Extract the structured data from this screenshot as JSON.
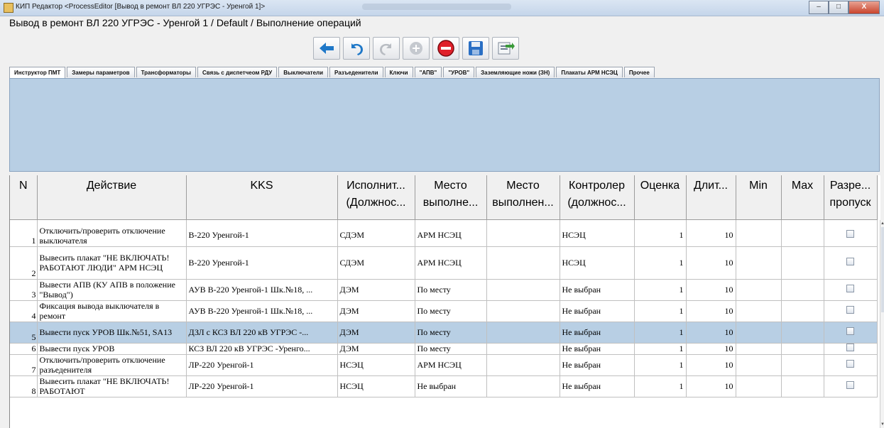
{
  "window": {
    "title": "КИП Редактор <ProcessEditor [Вывод в ремонт ВЛ 220 УГРЭС - Уренгой 1]>",
    "buttons": {
      "minimize": "‒",
      "maximize": "□",
      "close": "X"
    }
  },
  "header": {
    "title": "Вывод в ремонт ВЛ 220 УГРЭС - Уренгой 1 / Default /   Выполнение операций"
  },
  "toolbar": {
    "buttons": [
      {
        "icon": "arrow-left-icon",
        "color": "#1f78c8"
      },
      {
        "icon": "undo-icon",
        "color": "#1f78c8"
      },
      {
        "icon": "redo-icon",
        "color": "#b8bcc2"
      },
      {
        "icon": "add-icon",
        "color": "#b8bcc2"
      },
      {
        "icon": "stop-icon",
        "color": "#e0202a"
      },
      {
        "icon": "save-icon",
        "color": "#2a6fc4"
      },
      {
        "icon": "export-icon",
        "color": "#3a7a3a"
      }
    ]
  },
  "tabs": [
    {
      "label": "Инструктор ПМТ",
      "active": true
    },
    {
      "label": "Замеры параметров"
    },
    {
      "label": "Трансформаторы"
    },
    {
      "label": "Связь с диспетчеом РДУ"
    },
    {
      "label": "Выключатели"
    },
    {
      "label": "Разъеденители"
    },
    {
      "label": "Ключи"
    },
    {
      "label": "\"АПВ\""
    },
    {
      "label": "\"УРОВ\""
    },
    {
      "label": "Заземляющие ножи (ЗН)"
    },
    {
      "label": "Плакаты АРМ НСЭЦ"
    },
    {
      "label": "Прочее"
    }
  ],
  "table": {
    "columns": [
      {
        "l1": "N",
        "l2": ""
      },
      {
        "l1": "Действие",
        "l2": ""
      },
      {
        "l1": "KKS",
        "l2": ""
      },
      {
        "l1": "Исполнит...",
        "l2": "(Должнос..."
      },
      {
        "l1": "Место",
        "l2": "выполне..."
      },
      {
        "l1": "Место",
        "l2": "выполнен..."
      },
      {
        "l1": "Контролер",
        "l2": "(должнос..."
      },
      {
        "l1": "Оценка",
        "l2": ""
      },
      {
        "l1": "Длит...",
        "l2": ""
      },
      {
        "l1": "Min",
        "l2": ""
      },
      {
        "l1": "Max",
        "l2": ""
      },
      {
        "l1": "Разре...",
        "l2": "пропуск"
      }
    ],
    "rows": [
      {
        "n": "1",
        "action": "Отключить/проверить отключение выключателя",
        "kks": "В-220 Уренгой-1",
        "executor": "СДЭМ",
        "place1": "АРМ НСЭЦ",
        "place2": "",
        "controller": "НСЭЦ",
        "score": "1",
        "duration": "10",
        "min": "",
        "max": "",
        "allow_skip": false,
        "selected": false
      },
      {
        "n": "2",
        "action": "Вывесить плакат \"НЕ ВКЛЮЧАТЬ! РАБОТАЮТ ЛЮДИ\" АРМ НСЭЦ",
        "kks": "В-220 Уренгой-1",
        "executor": "СДЭМ",
        "place1": "АРМ НСЭЦ",
        "place2": "",
        "controller": "НСЭЦ",
        "score": "1",
        "duration": "10",
        "min": "",
        "max": "",
        "allow_skip": false,
        "selected": false
      },
      {
        "n": "3",
        "action": "Вывести АПВ  (КУ АПВ в положение \"Вывод\")",
        "kks": "АУВ В-220 Уренгой-1 Шк.№18, ...",
        "executor": "ДЭМ",
        "place1": "По месту",
        "place2": "",
        "controller": "Не выбран",
        "score": "1",
        "duration": "10",
        "min": "",
        "max": "",
        "allow_skip": false,
        "selected": false
      },
      {
        "n": "4",
        "action": "Фиксация вывода выключателя в ремонт",
        "kks": "АУВ В-220 Уренгой-1 Шк.№18, ...",
        "executor": "ДЭМ",
        "place1": "По месту",
        "place2": "",
        "controller": "Не выбран",
        "score": "1",
        "duration": "10",
        "min": "",
        "max": "",
        "allow_skip": false,
        "selected": false
      },
      {
        "n": "5",
        "action": "Вывести пуск УРОВ Шк.№51, SA13",
        "kks": "ДЗЛ с КСЗ ВЛ 220 кВ УГРЭС -...",
        "executor": "ДЭМ",
        "place1": "По месту",
        "place2": "",
        "controller": "Не выбран",
        "score": "1",
        "duration": "10",
        "min": "",
        "max": "",
        "allow_skip": false,
        "selected": true
      },
      {
        "n": "6",
        "action": "Вывести пуск УРОВ",
        "kks": "КСЗ ВЛ 220 кВ УГРЭС -Уренго...",
        "executor": "ДЭМ",
        "place1": "По месту",
        "place2": "",
        "controller": "Не выбран",
        "score": "1",
        "duration": "10",
        "min": "",
        "max": "",
        "allow_skip": false,
        "selected": false
      },
      {
        "n": "7",
        "action": "Отключить/проверить отключение разъеденителя",
        "kks": "ЛР-220 Уренгой-1",
        "executor": "НСЭЦ",
        "place1": "АРМ НСЭЦ",
        "place2": "",
        "controller": "Не выбран",
        "score": "1",
        "duration": "10",
        "min": "",
        "max": "",
        "allow_skip": false,
        "selected": false
      },
      {
        "n": "8",
        "action": "Вывесить плакат \"НЕ ВКЛЮЧАТЬ! РАБОТАЮТ",
        "kks": "ЛР-220 Уренгой-1",
        "executor": "НСЭЦ",
        "place1": "Не выбран",
        "place2": "",
        "controller": "Не выбран",
        "score": "1",
        "duration": "10",
        "min": "",
        "max": "",
        "allow_skip": false,
        "selected": false
      }
    ]
  }
}
